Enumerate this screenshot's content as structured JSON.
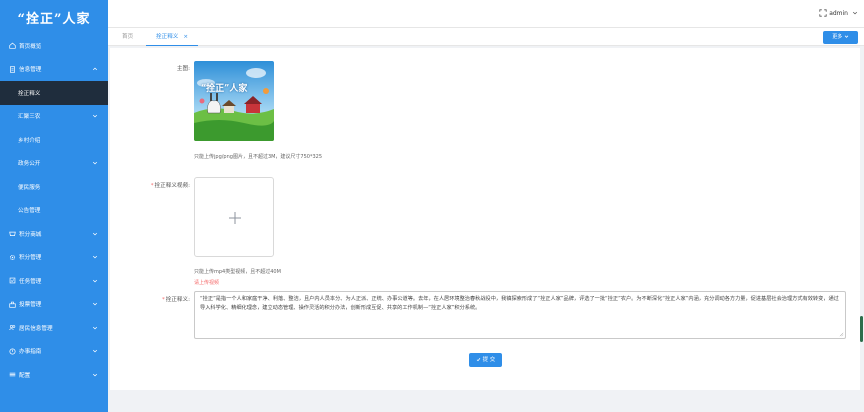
{
  "app": {
    "logo_text": "“拴正”人家"
  },
  "sidebar": {
    "items": [
      {
        "label": "首页概览",
        "icon": "home-icon",
        "chevron": false,
        "sub": false,
        "active": false
      },
      {
        "label": "信息管理",
        "icon": "document-icon",
        "chevron": "up",
        "sub": false,
        "active": false
      },
      {
        "label": "拴正释义",
        "icon": "",
        "chevron": false,
        "sub": true,
        "active": true
      },
      {
        "label": "汇聚三农",
        "icon": "",
        "chevron": "down",
        "sub": true,
        "active": false
      },
      {
        "label": "乡村介绍",
        "icon": "",
        "chevron": false,
        "sub": true,
        "active": false
      },
      {
        "label": "政务公开",
        "icon": "",
        "chevron": "down",
        "sub": true,
        "active": false
      },
      {
        "label": "便民服务",
        "icon": "",
        "chevron": false,
        "sub": true,
        "active": false
      },
      {
        "label": "公告管理",
        "icon": "",
        "chevron": false,
        "sub": true,
        "active": false
      },
      {
        "label": "积分商城",
        "icon": "store-icon",
        "chevron": "down",
        "sub": false,
        "active": false
      },
      {
        "label": "积分管理",
        "icon": "gear-icon",
        "chevron": "down",
        "sub": false,
        "active": false
      },
      {
        "label": "任务管理",
        "icon": "task-icon",
        "chevron": "down",
        "sub": false,
        "active": false
      },
      {
        "label": "投票管理",
        "icon": "vote-icon",
        "chevron": "down",
        "sub": false,
        "active": false
      },
      {
        "label": "居民信息管理",
        "icon": "users-icon",
        "chevron": "down",
        "sub": false,
        "active": false
      },
      {
        "label": "办事指南",
        "icon": "guide-icon",
        "chevron": "down",
        "sub": false,
        "active": false
      },
      {
        "label": "配置",
        "icon": "config-icon",
        "chevron": "down",
        "sub": false,
        "active": false
      }
    ]
  },
  "header": {
    "user_name": "admin"
  },
  "tabs": {
    "home_label": "首页",
    "current_label": "拴正释义",
    "close_glyph": "×"
  },
  "more_button": {
    "label": "更多"
  },
  "form": {
    "cover": {
      "label": "主图:",
      "image_text": "“拴正”人家",
      "hint": "只能上传jpg/png图片，且不超过3M，建议尺寸750*325"
    },
    "video": {
      "label": "拴正释义视频:",
      "hint": "只能上传mp4类型视频，且不超过40M",
      "error": "请上传视频"
    },
    "definition": {
      "label": "拴正释义:",
      "value": "“拴正”是指一个人和家庭干净、利落、整洁，且户内人员本分、为人正派、正统、办事公道等。去年，在人居环境整治春秋战役中，我镇探索形成了“拴正人家”品牌，评选了一批“拴正”农户。为不断深化“拴正人家”内涵，充分调动各方力量，促进基层社会治理方式有效转变，通过导入科学化、精细化理念，建立动态管理、操作灵活的积分办法，创新形成互促、共享的工作机制—“拴正人家”积分系统。"
    },
    "submit_label": "提 交"
  },
  "colors": {
    "primary": "#2f8ee8",
    "sidebar_active": "#1f2d3d",
    "danger": "#f56c6c"
  }
}
